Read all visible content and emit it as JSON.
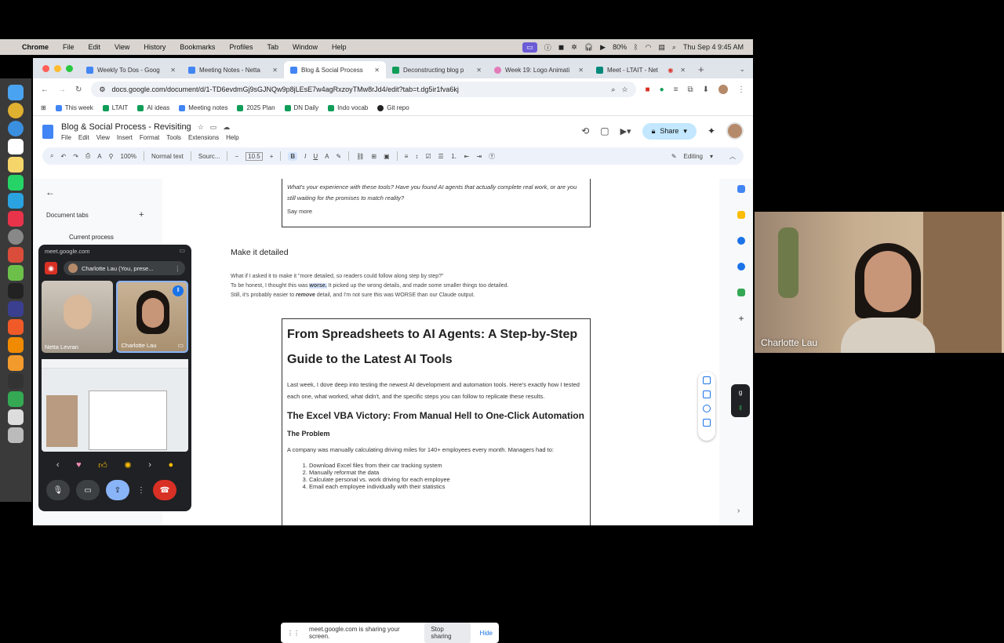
{
  "menubar": {
    "app": "Chrome",
    "items": [
      "File",
      "Edit",
      "View",
      "History",
      "Bookmarks",
      "Profiles",
      "Tab",
      "Window",
      "Help"
    ],
    "battery": "80%",
    "datetime": "Thu Sep 4  9:45 AM"
  },
  "tabs": [
    {
      "title": "Weekly To Dos - Goog",
      "color": "#4285f4"
    },
    {
      "title": "Meeting Notes - Netta",
      "color": "#4285f4"
    },
    {
      "title": "Blog & Social Process",
      "color": "#4285f4"
    },
    {
      "title": "Deconstructing blog p",
      "color": "#0f9d58"
    },
    {
      "title": "Week 19: Logo Animati",
      "color": "#e37bb8"
    },
    {
      "title": "Meet - LTAIT - Net",
      "color": "#00897b"
    }
  ],
  "url": "docs.google.com/document/d/1-TD6evdmGj9sGJNQw9p8jLEsE7w4agRxzoyTMw8rJd4/edit?tab=t.dg5ir1fva6kj",
  "bookmarks": [
    {
      "label": "This week",
      "color": "#4285f4"
    },
    {
      "label": "LTAIT",
      "color": "#0f9d58"
    },
    {
      "label": "AI ideas",
      "color": "#0f9d58"
    },
    {
      "label": "Meeting notes",
      "color": "#4285f4"
    },
    {
      "label": "2025 Plan",
      "color": "#0f9d58"
    },
    {
      "label": "DN Daily",
      "color": "#0f9d58"
    },
    {
      "label": "Indo vocab",
      "color": "#0f9d58"
    },
    {
      "label": "Git repo",
      "color": "#222222"
    }
  ],
  "doc": {
    "title": "Blog & Social Process - Revisiting",
    "menu": [
      "File",
      "Edit",
      "View",
      "Insert",
      "Format",
      "Tools",
      "Extensions",
      "Help"
    ],
    "share": "Share",
    "toolbar": {
      "zoom": "100%",
      "style": "Normal text",
      "font": "Sourc...",
      "size": "10.5",
      "mode": "Editing"
    }
  },
  "left_panel": {
    "doc_tabs": "Document tabs",
    "current": "Current process"
  },
  "content": {
    "box1_italic": "What's your experience with these tools? Have you found AI agents that actually complete real work, or are you still waiting for the promises to match reality?",
    "box1_say": "Say more",
    "heading": "Make it detailed",
    "p1": "What if I asked it to make it \"more detailed, so readers could follow along step by step?\"",
    "p2a": "To be honest, I thought this was ",
    "p2b": "worse.",
    "p2c": " It picked up the wrong details, and made some smaller things too detailed.",
    "p3a": "Still, it's probably easier to ",
    "p3b": "remove",
    "p3c": " detail, and I'm not sure this was WORSE than our Claude output.",
    "h1": "From Spreadsheets to AI Agents: A Step-by-Step Guide to the Latest AI Tools",
    "intro": "Last week, I dove deep into testing the newest AI development and automation tools. Here's exactly how I tested each one, what worked, what didn't, and the specific steps you can follow to replicate these results.",
    "h2": "The Excel VBA Victory: From Manual Hell to One-Click Automation",
    "h3": "The Problem",
    "problem": "A company was manually calculating driving miles for 140+ employees every month. Managers had to:",
    "steps": [
      "Download Excel files from their car tracking system",
      "Manually reformat the data",
      "Calculate personal vs. work driving for each employee",
      "Email each employee individually with their statistics"
    ]
  },
  "sharebar": {
    "msg": "meet.google.com is sharing your screen.",
    "stop": "Stop sharing",
    "hide": "Hide"
  },
  "pip": {
    "url": "meet.google.com",
    "presenter": "Charlotte Lau (You, prese...",
    "p1": "Netta Levran",
    "p2": "Charlotte Lau"
  },
  "speaker": {
    "name": "Charlotte Lau"
  }
}
